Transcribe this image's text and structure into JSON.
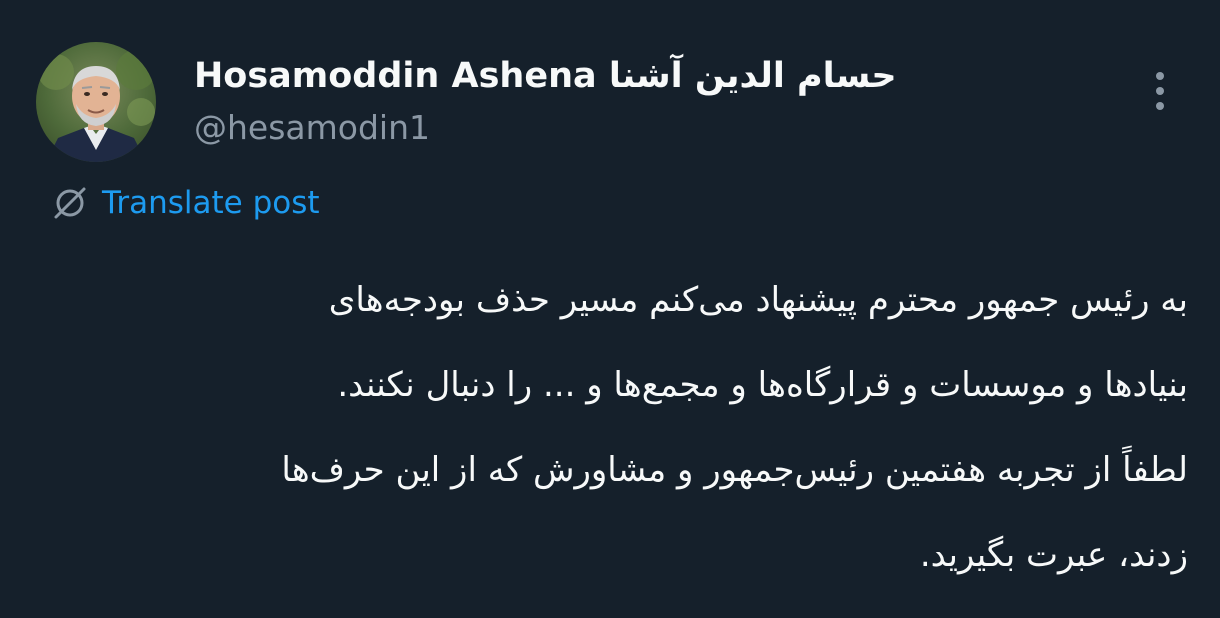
{
  "author": {
    "display_name": "Hosamoddin Ashena حسام الدين آشنا",
    "handle": "@hesamodin1",
    "avatar_icon": "profile-photo"
  },
  "actions": {
    "more_icon": "more-vertical-icon",
    "translate_icon": "translate-icon",
    "translate_label": "Translate post"
  },
  "post": {
    "lines": [
      "به رئیس جمهور محترم پیشنهاد می‌کنم مسیر حذف بودجه‌های",
      "بنیادها و موسسات و  قرارگاه‌ها و مجمع‌ها و ... را دنبال نکنند.",
      "لطفاً از تجربه هفتمین رئیس‌جمهور و مشاورش که از این حرف‌ها",
      "زدند، عبرت بگیرید."
    ]
  },
  "colors": {
    "background": "#15202b",
    "primary_text": "#f7f9f9",
    "secondary_text": "#8b98a5",
    "link": "#1d9bf0"
  }
}
